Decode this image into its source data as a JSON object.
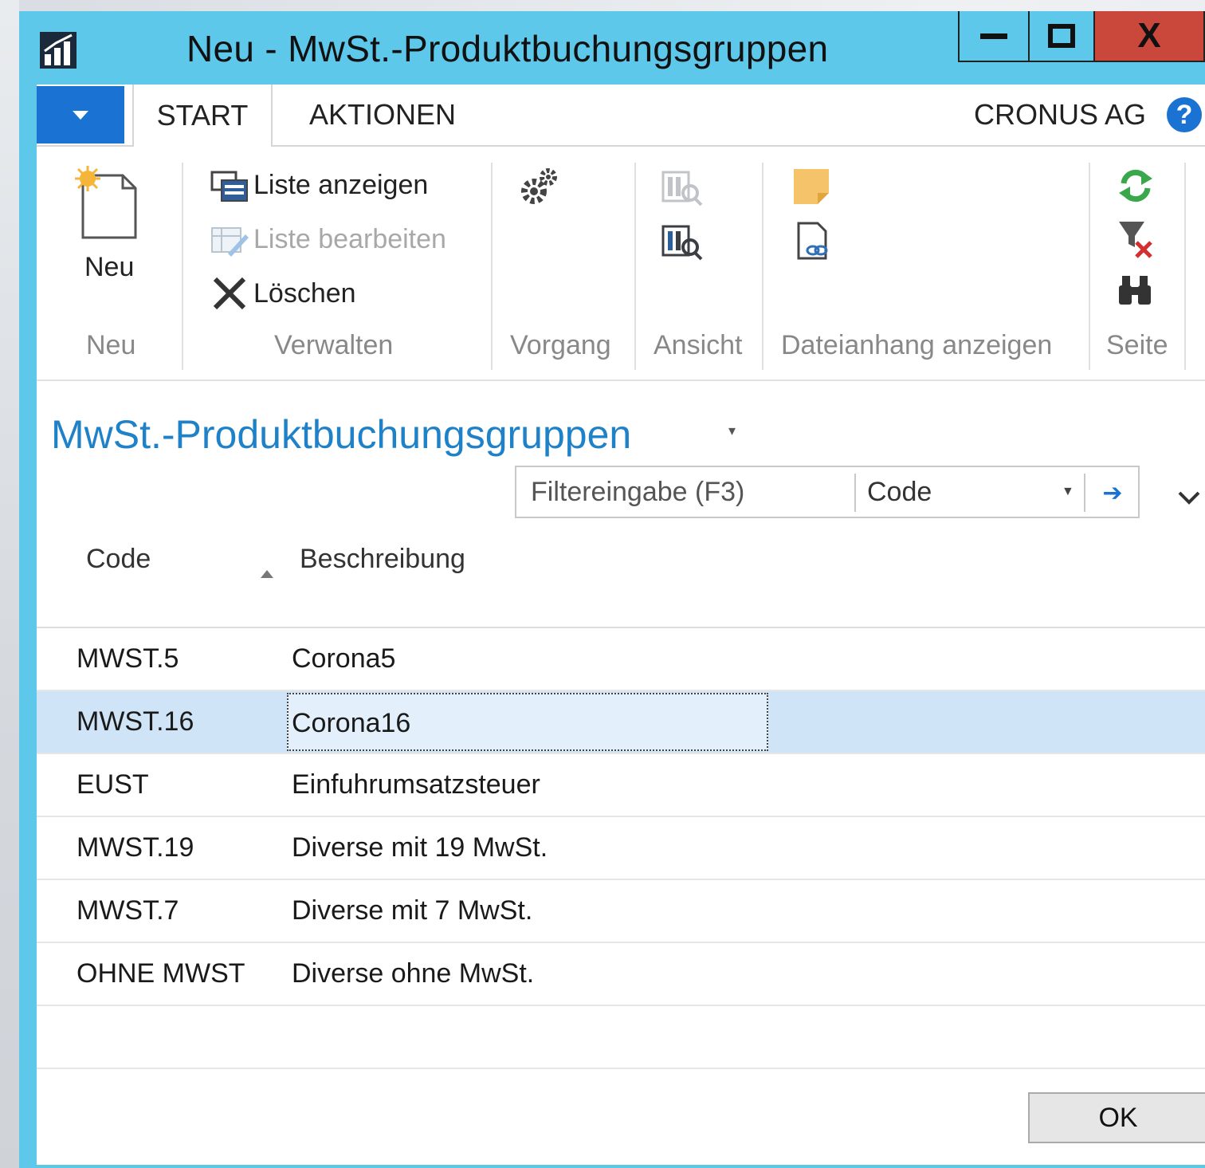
{
  "window": {
    "title": "Neu - MwSt.-Produktbuchungsgruppen",
    "controls": {
      "minimize_icon": "minimize-icon",
      "maximize_icon": "maximize-icon",
      "close_label": "X"
    }
  },
  "tabs": [
    {
      "label": "START",
      "active": true
    },
    {
      "label": "AKTIONEN",
      "active": false
    }
  ],
  "company": "CRONUS AG",
  "help_label": "?",
  "ribbon": {
    "groups": {
      "neu": "Neu",
      "verwalten": "Verwalten",
      "vorgang": "Vorgang",
      "ansicht": "Ansicht",
      "dateianhang": "Dateianhang anzeigen",
      "seite": "Seite"
    },
    "new_label": "Neu",
    "list_show": "Liste anzeigen",
    "list_edit": "Liste bearbeiten",
    "delete": "Löschen"
  },
  "page": {
    "title": "MwSt.-Produktbuchungsgruppen"
  },
  "filter": {
    "placeholder": "Filtereingabe (F3)",
    "field": "Code"
  },
  "table": {
    "columns": [
      "Code",
      "Beschreibung"
    ],
    "sort_column": "Code",
    "rows": [
      {
        "code": "MWST.5",
        "description": "Corona5"
      },
      {
        "code": "MWST.16",
        "description": "Corona16"
      },
      {
        "code": "EUST",
        "description": "Einfuhrumsatzsteuer"
      },
      {
        "code": "MWST.19",
        "description": "Diverse mit 19 MwSt."
      },
      {
        "code": "MWST.7",
        "description": "Diverse mit 7 MwSt."
      },
      {
        "code": "OHNE MWST",
        "description": "Diverse ohne MwSt."
      }
    ],
    "selected_row": 1
  },
  "footer": {
    "ok_label": "OK"
  },
  "colors": {
    "titlebar": "#5ec8ea",
    "accent": "#1a73d2",
    "page_title": "#1f82c9",
    "selected_row": "#cfe4f7",
    "close_button": "#c9473b"
  }
}
